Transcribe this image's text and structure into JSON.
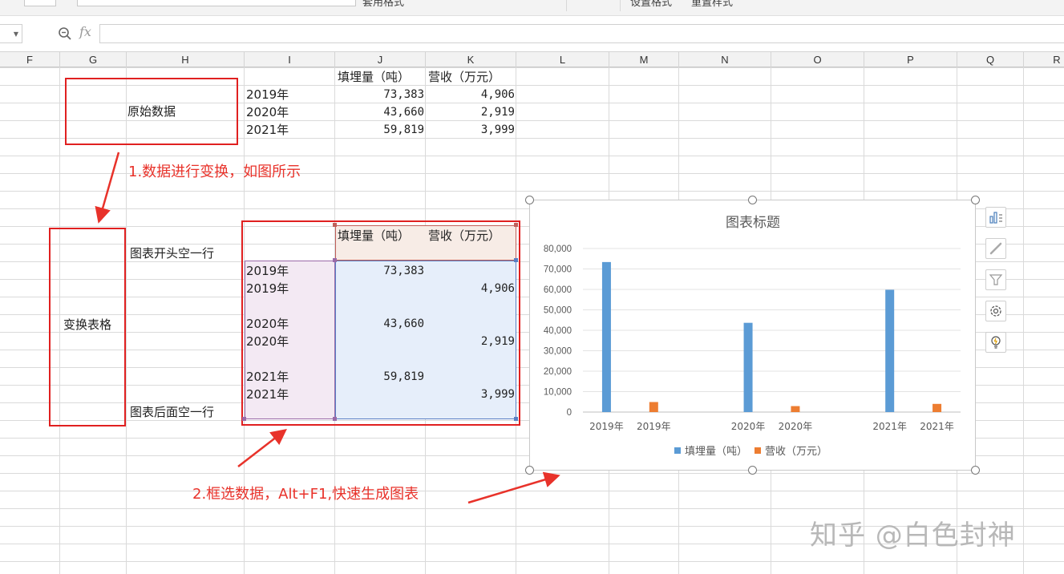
{
  "toolbar": {
    "items": [
      "套用格式",
      "设置格式",
      "重置样式"
    ]
  },
  "formula_bar": {
    "fx_label": "fx",
    "value": ""
  },
  "columns": [
    "F",
    "G",
    "H",
    "I",
    "J",
    "K",
    "L",
    "M",
    "N",
    "O",
    "P",
    "Q",
    "R"
  ],
  "original_table": {
    "label": "原始数据",
    "headers": [
      "填埋量（吨）",
      "营收（万元）"
    ],
    "rows": [
      {
        "year": "2019年",
        "landfill": "73,383",
        "revenue": "4,906"
      },
      {
        "year": "2020年",
        "landfill": "43,660",
        "revenue": "2,919"
      },
      {
        "year": "2021年",
        "landfill": "59,819",
        "revenue": "3,999"
      }
    ]
  },
  "transformed_table": {
    "label": "变换表格",
    "note_top": "图表开头空一行",
    "note_bottom": "图表后面空一行",
    "headers": [
      "填埋量（吨）",
      "营收（万元）"
    ],
    "rows": [
      {
        "year": "2019年",
        "landfill": "73,383",
        "revenue": ""
      },
      {
        "year": "2019年",
        "landfill": "",
        "revenue": "4,906"
      },
      {
        "year": "",
        "landfill": "",
        "revenue": ""
      },
      {
        "year": "2020年",
        "landfill": "43,660",
        "revenue": ""
      },
      {
        "year": "2020年",
        "landfill": "",
        "revenue": "2,919"
      },
      {
        "year": "",
        "landfill": "",
        "revenue": ""
      },
      {
        "year": "2021年",
        "landfill": "59,819",
        "revenue": ""
      },
      {
        "year": "2021年",
        "landfill": "",
        "revenue": "3,999"
      }
    ]
  },
  "annotations": {
    "step1": "1.数据进行变换，如图所示",
    "step2": "2.框选数据，Alt+F1,快速生成图表"
  },
  "watermark": "知乎 @白色封神",
  "side_buttons": [
    "chart-elements-icon",
    "chart-style-icon",
    "chart-filter-icon",
    "settings-icon",
    "idea-bulb-icon"
  ],
  "colors": {
    "landfill": "#5b9bd5",
    "revenue": "#ed7d31",
    "annotation": "#e8322a"
  },
  "chart_data": {
    "type": "bar",
    "title": "图表标题",
    "categories": [
      "2019年",
      "2019年",
      "",
      "2020年",
      "2020年",
      "",
      "2021年",
      "2021年"
    ],
    "series": [
      {
        "name": "填埋量（吨）",
        "values": [
          73383,
          null,
          null,
          43660,
          null,
          null,
          59819,
          null
        ]
      },
      {
        "name": "营收（万元）",
        "values": [
          null,
          4906,
          null,
          null,
          2919,
          null,
          null,
          3999
        ]
      }
    ],
    "yticks": [
      "0",
      "10,000",
      "20,000",
      "30,000",
      "40,000",
      "50,000",
      "60,000",
      "70,000",
      "80,000"
    ],
    "ylim": [
      0,
      80000
    ],
    "grid": true,
    "legend": "bottom"
  }
}
